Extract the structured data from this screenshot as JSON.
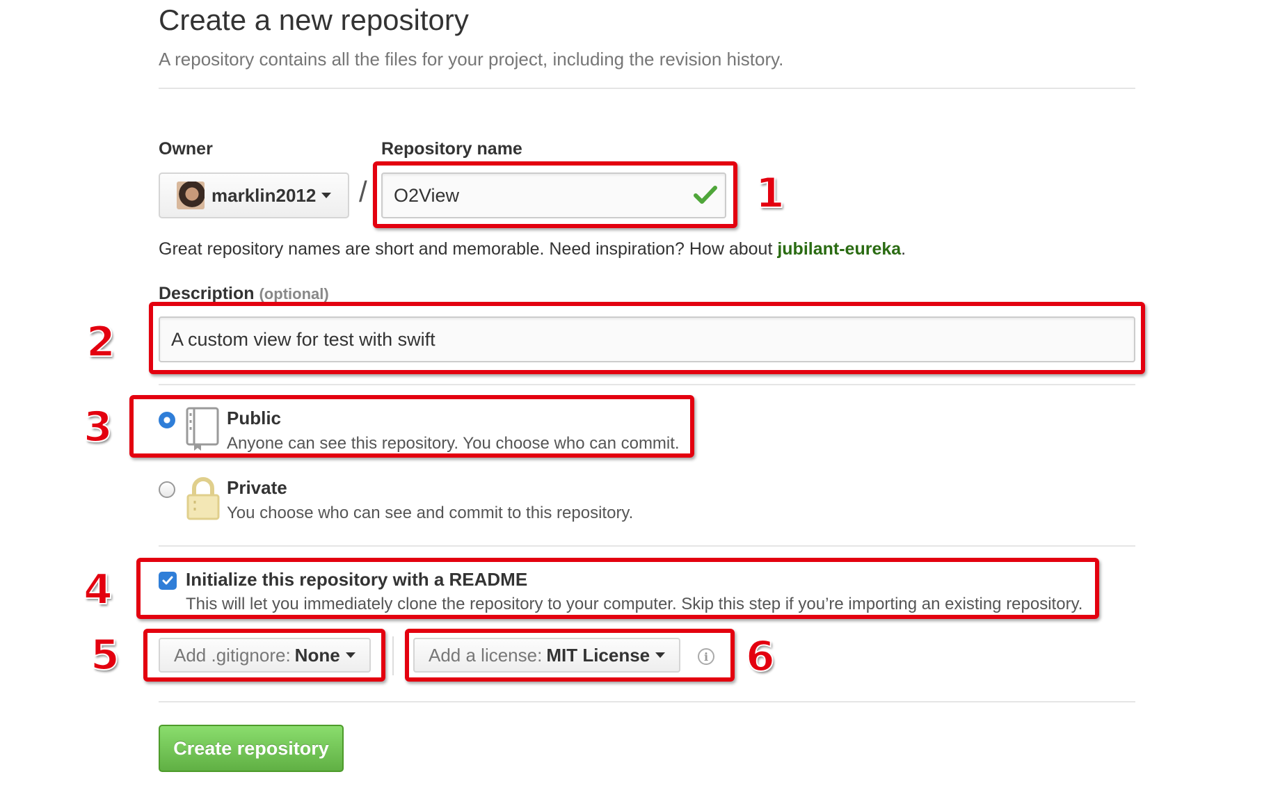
{
  "header": {
    "title": "Create a new repository",
    "subtitle": "A repository contains all the files for your project, including the revision history."
  },
  "owner": {
    "label": "Owner",
    "value": "marklin2012"
  },
  "separator_slash": "/",
  "repo_name": {
    "label": "Repository name",
    "value": "O2View"
  },
  "hint": {
    "text": "Great repository names are short and memorable. Need inspiration? How about ",
    "suggestion": "jubilant-eureka",
    "suffix": "."
  },
  "description": {
    "label": "Description",
    "optional_label": "(optional)",
    "value": "A custom view for test with swift"
  },
  "visibility": {
    "public": {
      "title": "Public",
      "desc": "Anyone can see this repository. You choose who can commit.",
      "checked": true
    },
    "private": {
      "title": "Private",
      "desc": "You choose who can see and commit to this repository.",
      "checked": false
    }
  },
  "init_readme": {
    "title": "Initialize this repository with a README",
    "desc": "This will let you immediately clone the repository to your computer. Skip this step if you’re importing an existing repository.",
    "checked": true
  },
  "gitignore": {
    "prefix": "Add .gitignore:",
    "value": "None"
  },
  "license": {
    "prefix": "Add a license:",
    "value": "MIT License"
  },
  "create_button": {
    "label": "Create repository"
  },
  "annotations": [
    "1",
    "2",
    "3",
    "4",
    "5",
    "6"
  ],
  "colors": {
    "annotation": "#e3000f",
    "primary_button": "#60b044",
    "suggestion": "#2a6b12",
    "radio_checked": "#2f7ed8"
  }
}
